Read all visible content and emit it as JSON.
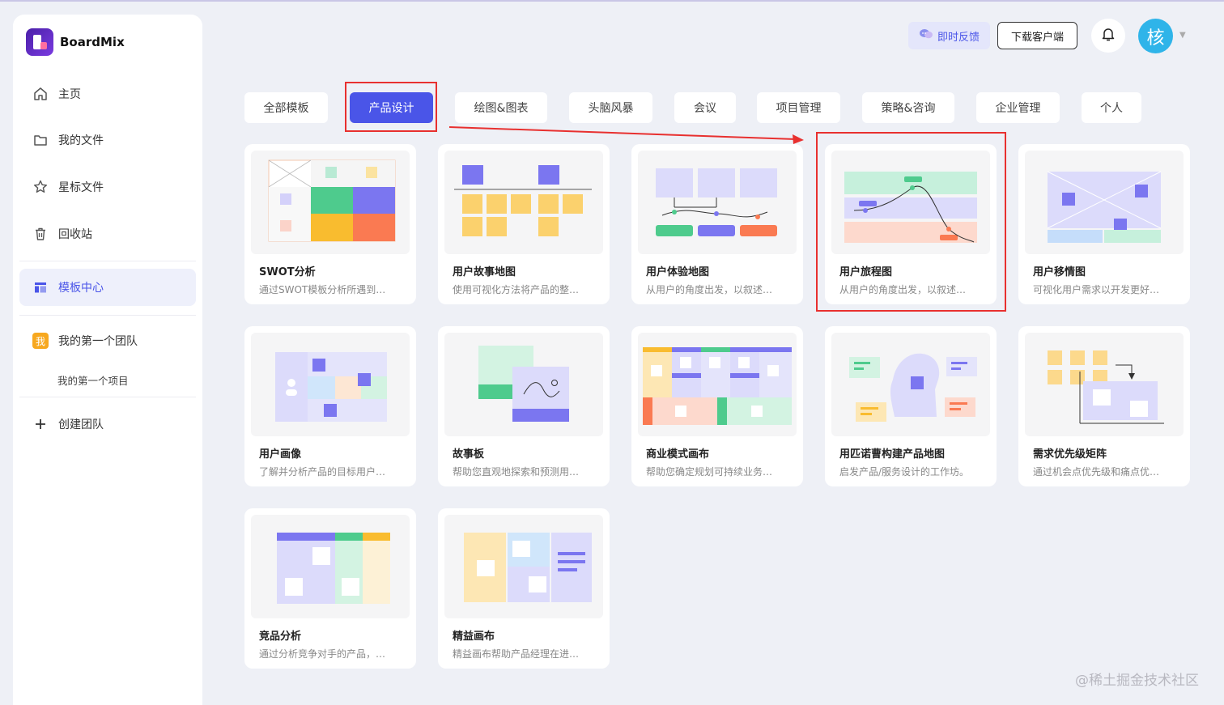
{
  "app": {
    "name": "BoardMix"
  },
  "sidebar": {
    "items": [
      {
        "label": "主页",
        "icon": "home-icon"
      },
      {
        "label": "我的文件",
        "icon": "folder-icon"
      },
      {
        "label": "星标文件",
        "icon": "star-icon"
      },
      {
        "label": "回收站",
        "icon": "trash-icon"
      },
      {
        "label": "模板中心",
        "icon": "template-icon",
        "active": true
      }
    ],
    "team": {
      "badge": "我",
      "label": "我的第一个团队",
      "project": "我的第一个项目"
    },
    "create_team": "创建团队"
  },
  "header": {
    "feedback": "即时反馈",
    "download": "下载客户端",
    "avatar_initial": "核"
  },
  "tabs": [
    {
      "label": "全部模板"
    },
    {
      "label": "产品设计",
      "active": true
    },
    {
      "label": "绘图&图表"
    },
    {
      "label": "头脑风暴"
    },
    {
      "label": "会议"
    },
    {
      "label": "项目管理"
    },
    {
      "label": "策略&咨询"
    },
    {
      "label": "企业管理"
    },
    {
      "label": "个人"
    }
  ],
  "templates": [
    {
      "title": "SWOT分析",
      "desc": "通过SWOT模板分析所遇到…"
    },
    {
      "title": "用户故事地图",
      "desc": "使用可视化方法将产品的整…"
    },
    {
      "title": "用户体验地图",
      "desc": "从用户的角度出发，以叙述…"
    },
    {
      "title": "用户旅程图",
      "desc": "从用户的角度出发，以叙述…"
    },
    {
      "title": "用户移情图",
      "desc": "可视化用户需求以开发更好…"
    },
    {
      "title": "用户画像",
      "desc": "了解并分析产品的目标用户…"
    },
    {
      "title": "故事板",
      "desc": "帮助您直观地探索和预测用…"
    },
    {
      "title": "商业模式画布",
      "desc": "帮助您确定规划可持续业务…"
    },
    {
      "title": "用匹诺曹构建产品地图",
      "desc": "启发产品/服务设计的工作坊。"
    },
    {
      "title": "需求优先级矩阵",
      "desc": "通过机会点优先级和痛点优…"
    },
    {
      "title": "竞品分析",
      "desc": "通过分析竞争对手的产品，…"
    },
    {
      "title": "精益画布",
      "desc": "精益画布帮助产品经理在进…"
    }
  ],
  "watermark": "@稀土掘金技术社区",
  "colors": {
    "accent": "#4a55e8",
    "highlight": "#e8302f"
  }
}
